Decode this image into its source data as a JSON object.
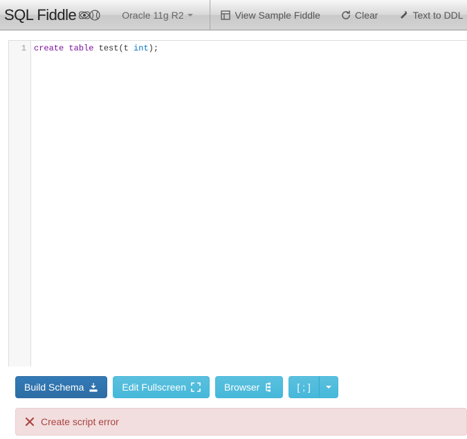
{
  "brand": "SQL Fiddle",
  "db_engine": "Oracle 11g R2",
  "nav": {
    "view_sample": "View Sample Fiddle",
    "clear": "Clear",
    "text_to_ddl": "Text to DDL"
  },
  "editor": {
    "line_numbers": [
      "1"
    ],
    "code_tokens": [
      {
        "t": "create",
        "c": "kw"
      },
      {
        "t": " ",
        "c": "pl"
      },
      {
        "t": "table",
        "c": "kw"
      },
      {
        "t": " test(t ",
        "c": "pl"
      },
      {
        "t": "int",
        "c": "ty"
      },
      {
        "t": ");",
        "c": "pl"
      }
    ]
  },
  "toolbar": {
    "build_schema": "Build Schema",
    "edit_fullscreen": "Edit Fullscreen",
    "browser": "Browser",
    "terminator": "[ ; ]"
  },
  "alert": {
    "message": "Create script error"
  }
}
